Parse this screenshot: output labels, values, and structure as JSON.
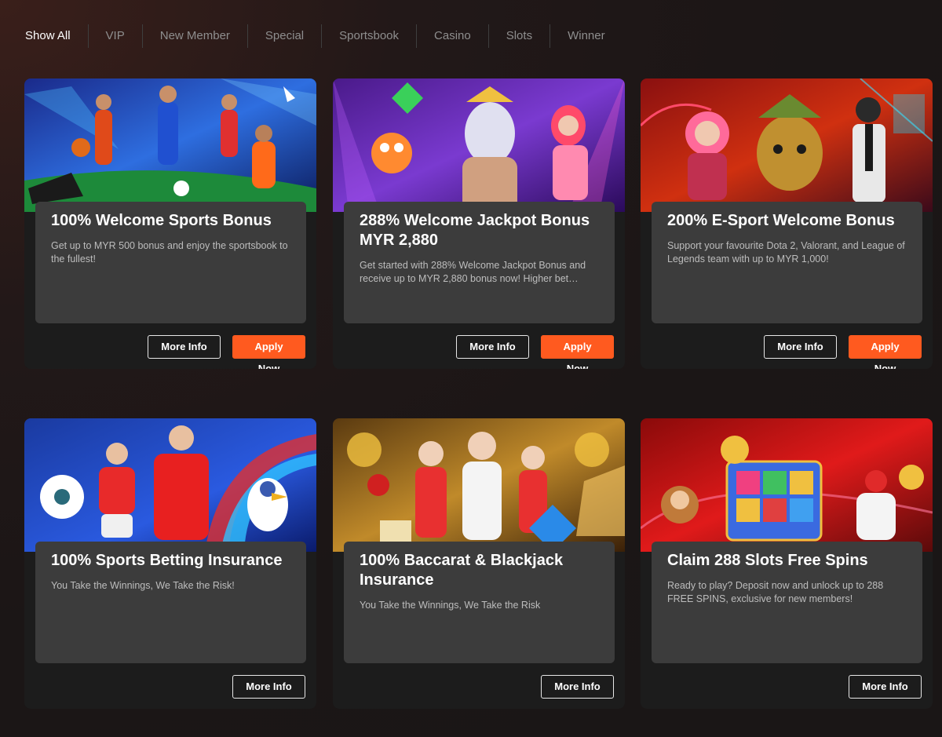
{
  "tabs": [
    "Show All",
    "VIP",
    "New Member",
    "Special",
    "Sportsbook",
    "Casino",
    "Slots",
    "Winner"
  ],
  "active_tab": "Show All",
  "buttons": {
    "more_info": "More Info",
    "apply_now": "Apply Now"
  },
  "colors": {
    "accent": "#ff5a1f",
    "card_bg": "#1c1c1c",
    "panel_bg": "#3c3c3c",
    "page_bg": "#1a1616"
  },
  "promos": [
    {
      "title": "100% Welcome Sports Bonus",
      "desc": "Get up to MYR 500 bonus and enjoy the sportsbook to the fullest!",
      "apply": true,
      "banner": "sports-players-banner"
    },
    {
      "title": "288% Welcome Jackpot Bonus MYR 2,880",
      "desc": "Get started with 288% Welcome Jackpot Bonus and receive up to MYR 2,880 bonus now! Higher bet amoun...",
      "apply": true,
      "banner": "slot-characters-banner"
    },
    {
      "title": "200% E-Sport Welcome Bonus",
      "desc": "Support your favourite Dota 2, Valorant, and League of Legends team with up to MYR 1,000!",
      "apply": true,
      "banner": "esport-characters-banner"
    },
    {
      "title": "100% Sports Betting Insurance",
      "desc": "You Take the Winnings, We Take the Risk!",
      "apply": false,
      "banner": "football-banner"
    },
    {
      "title": "100% Baccarat & Blackjack Insurance",
      "desc": "You Take the Winnings, We Take the Risk",
      "apply": false,
      "banner": "live-casino-banner"
    },
    {
      "title": "Claim 288 Slots Free Spins",
      "desc": "Ready to play? Deposit now and unlock up to 288 FREE SPINS, exclusive for new members!",
      "apply": false,
      "banner": "slots-free-spins-banner"
    }
  ]
}
